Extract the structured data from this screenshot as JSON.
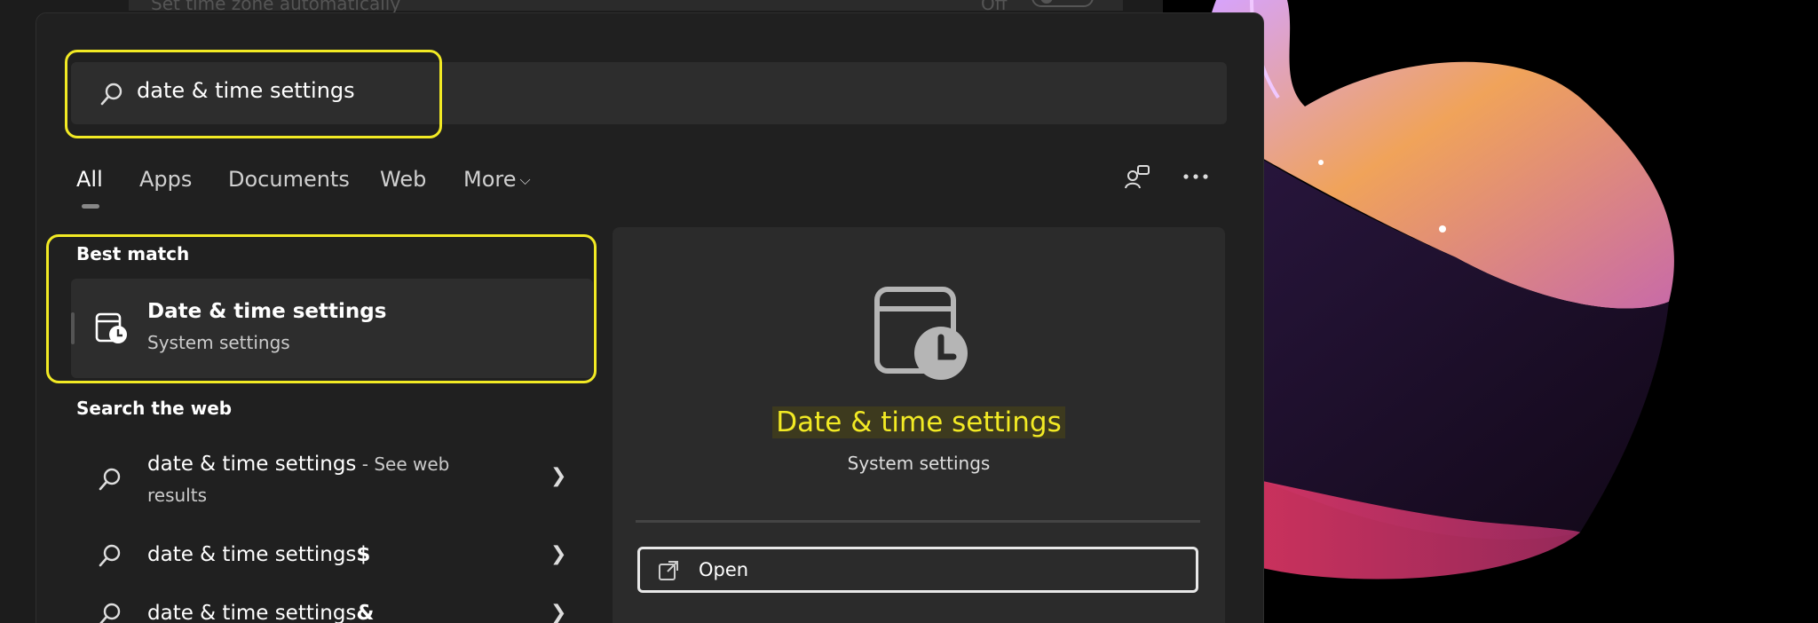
{
  "background": {
    "settings_text": "Set time zone automatically",
    "toggle_label": "Off"
  },
  "search": {
    "query": "date & time settings"
  },
  "tabs": [
    {
      "label": "All",
      "active": true
    },
    {
      "label": "Apps"
    },
    {
      "label": "Documents"
    },
    {
      "label": "Web"
    },
    {
      "label": "More"
    }
  ],
  "toolbar_icons": [
    "switch-account-icon",
    "more-options-icon"
  ],
  "best_match": {
    "section_title": "Best match",
    "name": "Date & time settings",
    "subtitle": "System settings",
    "icon": "calendar-clock-icon"
  },
  "search_web": {
    "section_title": "Search the web",
    "items": [
      {
        "query": "date & time settings",
        "suffix": " - See web",
        "suffix_cont": "results"
      },
      {
        "query": "date & time settings",
        "bold_suffix": "$"
      },
      {
        "query": "date & time settings",
        "bold_suffix": "&"
      }
    ]
  },
  "detail": {
    "title": "Date & time settings",
    "subtitle": "System settings",
    "open_label": "Open"
  },
  "colors": {
    "highlight": "#f2ea24",
    "panel": "#202020",
    "card": "#2d2d2d"
  }
}
